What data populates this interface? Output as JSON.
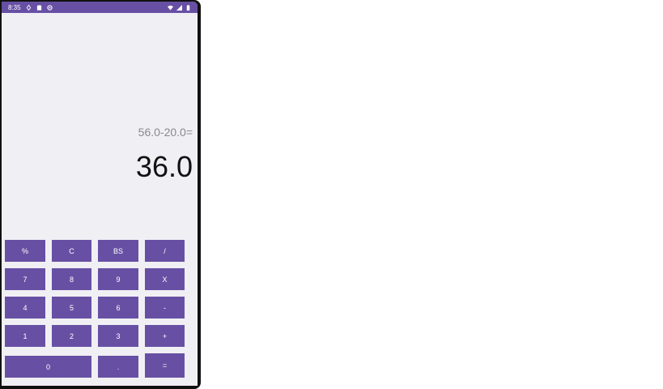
{
  "status_bar": {
    "time": "8:35",
    "icons": [
      "location-icon",
      "sd-card-icon",
      "vpn-icon"
    ],
    "right_icons": [
      "wifi-icon",
      "signal-icon",
      "battery-icon"
    ]
  },
  "display": {
    "expression": "56.0-20.0=",
    "result": "36.0"
  },
  "keys": {
    "percent": "%",
    "clear": "C",
    "backspace": "BS",
    "divide": "/",
    "seven": "7",
    "eight": "8",
    "nine": "9",
    "multiply": "X",
    "four": "4",
    "five": "5",
    "six": "6",
    "minus": "-",
    "one": "1",
    "two": "2",
    "three": "3",
    "plus": "+",
    "zero": "0",
    "dot": ".",
    "equals": "="
  },
  "colors": {
    "accent": "#6750a4",
    "background": "#f0eff4"
  }
}
